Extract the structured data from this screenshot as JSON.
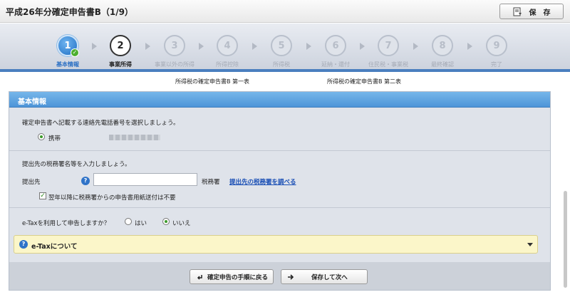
{
  "window": {
    "title": "平成26年分確定申告書B（1/9）"
  },
  "toolbar": {
    "save_label": "保　存",
    "save_icon": "save-doc-icon"
  },
  "steps": [
    {
      "num": "1",
      "label": "基本情報",
      "state": "done"
    },
    {
      "num": "2",
      "label": "事業所得",
      "state": "current"
    },
    {
      "num": "3",
      "label": "事業以外の所得",
      "state": "pending"
    },
    {
      "num": "4",
      "label": "所得控除",
      "state": "pending"
    },
    {
      "num": "5",
      "label": "所得税",
      "state": "pending"
    },
    {
      "num": "6",
      "label": "延納・還付",
      "state": "pending"
    },
    {
      "num": "7",
      "label": "住民税・事業税",
      "state": "pending"
    },
    {
      "num": "8",
      "label": "最終確認",
      "state": "pending"
    },
    {
      "num": "9",
      "label": "完了",
      "state": "pending"
    }
  ],
  "subheads": {
    "left": "所得税の確定申告書B 第一表",
    "right": "所得税の確定申告書B 第二表"
  },
  "panel": {
    "title": "基本情報",
    "phone": {
      "prompt": "確定申告書へ記載する連絡先電話番号を選択しましょう。",
      "option_label": "携帯"
    },
    "office": {
      "prompt": "提出先の税務署名等を入力しましょう。",
      "field_label": "提出先",
      "field_value": "",
      "suffix": "税務署",
      "lookup_link": "提出先の税務署を調べる",
      "checkbox_label": "翌年以降に税務署からの申告書用紙送付は不要",
      "checkbox_checked": true
    },
    "etax": {
      "question": "e-Taxを利用して申告しますか？",
      "yes": "はい",
      "no": "いいえ",
      "selected": "no",
      "info_title": "e-Taxについて"
    }
  },
  "buttons": {
    "back": "確定申告の手順に戻る",
    "next": "保存して次へ"
  }
}
